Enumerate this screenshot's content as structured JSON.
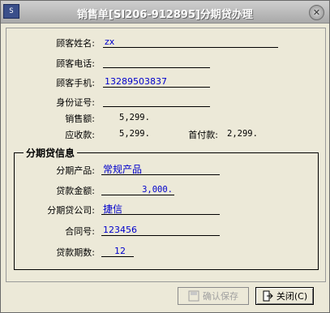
{
  "window": {
    "title": "销售单[SI206-912895]分期贷办理",
    "close_glyph": "✕",
    "app_icon_text": "S"
  },
  "customer": {
    "name_label": "顾客姓名:",
    "name_value": "zx",
    "phone_label": "顾客电话:",
    "phone_value": "",
    "mobile_label": "顾客手机:",
    "mobile_value": "13289503837",
    "id_label": "身份证号:",
    "id_value": "",
    "sales_amount_label": "销售额:",
    "sales_amount_value": "5,299.",
    "receivable_label": "应收款:",
    "receivable_value": "5,299.",
    "down_payment_label": "首付款:",
    "down_payment_value": "2,299."
  },
  "installment": {
    "group_title": "分期贷信息",
    "product_label": "分期产品:",
    "product_value": "常规产品",
    "loan_amount_label": "贷款金额:",
    "loan_amount_value": "3,000.",
    "company_label": "分期贷公司:",
    "company_value": "捷信",
    "contract_label": "合同号:",
    "contract_value": "123456",
    "periods_label": "贷款期数:",
    "periods_value": "12"
  },
  "buttons": {
    "save_label": "确认保存",
    "close_label": "关闭(C)"
  },
  "colors": {
    "value_text": "#0000cc",
    "background": "#ece9d8"
  }
}
